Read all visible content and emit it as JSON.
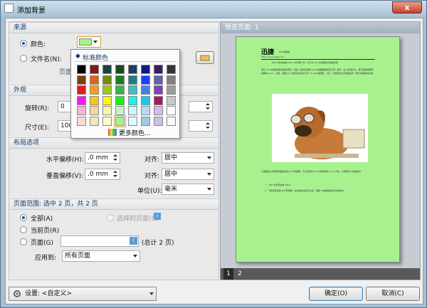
{
  "window": {
    "title": "添加背景",
    "close_label": "x"
  },
  "source": {
    "header": "来源",
    "color_label": "颜色:",
    "color_value": "#a8f18f",
    "file_label": "文件名(N):",
    "page_label": "页面:"
  },
  "appearance": {
    "header": "外观",
    "rotation_label": "旋转(R):",
    "rotation_value": "0",
    "size_label": "尺寸(E):",
    "size_value": "100%"
  },
  "layout": {
    "header": "布局选项",
    "h_offset_label": "水平偏移(H):",
    "h_offset_value": ".0 mm",
    "v_offset_label": "垂直偏移(V):",
    "v_offset_value": ".0 mm",
    "align_label_1": "对齐:",
    "align_value_1": "居中",
    "align_label_2": "对齐:",
    "align_value_2": "居中",
    "unit_label": "单位(U):",
    "unit_value": "毫米"
  },
  "range": {
    "header": "页面范围: 选中 2 页，共 2 页",
    "all_label": "全部(A)",
    "selected_pages_label": "选择的页面(S)",
    "current_label": "当前页(R)",
    "pages_label": "页面(G)",
    "pages_input": "",
    "total_label": "(总计 2 页)",
    "apply_label": "应用到:",
    "apply_value": "所有页面"
  },
  "preview": {
    "header": "预览页面: 1",
    "tabs": [
      "1",
      "2"
    ],
    "doc_title": "迅捷",
    "doc_title_sub": "PDF编辑器",
    "doc_url": "http://www.xjpdf.com",
    "doc_heading": "PDF 文件的编辑 Word 文件哪个好？为什么 pdf 文件都显示得很好呢？",
    "doc_para1": "我们 pdf 文档的编辑常规性更高。但是一般浏览编辑 pdf 文档都需要用到工具？其实，在小学语文中，其它编辑等都有的那种 word、表格，编辑 pdf 文档后将来就不是一下 pdf 编辑器，今天，为编辑的文字或者是将一部分内容等合并等。",
    "doc_para2": "小编要给大家推荐的都是迅捷 pdf 转换器，可以直接将 pdf 文档转换成 word 文件。大家都可以试着操作！",
    "doc_item1": "一、PDF 文件转换成 Word",
    "doc_item2": "1、下载安装迅捷 pdf 转换器，在这些输出的可生活，选择\"\"的编辑等进行转换操作。"
  },
  "color_popup": {
    "header": "标准颜色",
    "more_label": "更多颜色...",
    "colors": [
      [
        "#000000",
        "#7f1c1c",
        "#1c3f3f",
        "#1c4a1c",
        "#1c3f5f",
        "#0c1c7f",
        "#3f1c5f",
        "#333333"
      ],
      [
        "#7f3f0c",
        "#e0641c",
        "#6f8c0c",
        "#1c7f1c",
        "#1c7f7f",
        "#1c3fff",
        "#5f5fb0",
        "#7f7f7f"
      ],
      [
        "#e01c1c",
        "#f59c1c",
        "#9cc81c",
        "#3fb04a",
        "#3fbfbf",
        "#4a7fe0",
        "#7f3fbf",
        "#9c9c9c"
      ],
      [
        "#f01cf0",
        "#f5c81c",
        "#f5f51c",
        "#1cf01c",
        "#1cf0f0",
        "#1cc8f0",
        "#a01c5f",
        "#c8c8c8"
      ],
      [
        "#f5b8c8",
        "#f5d8a0",
        "#f5f5b0",
        "#c8f0c8",
        "#c8f5f5",
        "#b8d8f5",
        "#d8b8f0",
        "#ffffff"
      ],
      [
        "#f5dcd0",
        "#f0e6b8",
        "#fafad0",
        "#a8f18f",
        "#dcfaff",
        "#a0c8e0",
        "#c8c0e0",
        "#f8f8f8"
      ]
    ]
  },
  "footer": {
    "settings_label": "设置:",
    "settings_value": "<自定义>",
    "ok_label": "确定(O)",
    "cancel_label": "取消(C)"
  }
}
